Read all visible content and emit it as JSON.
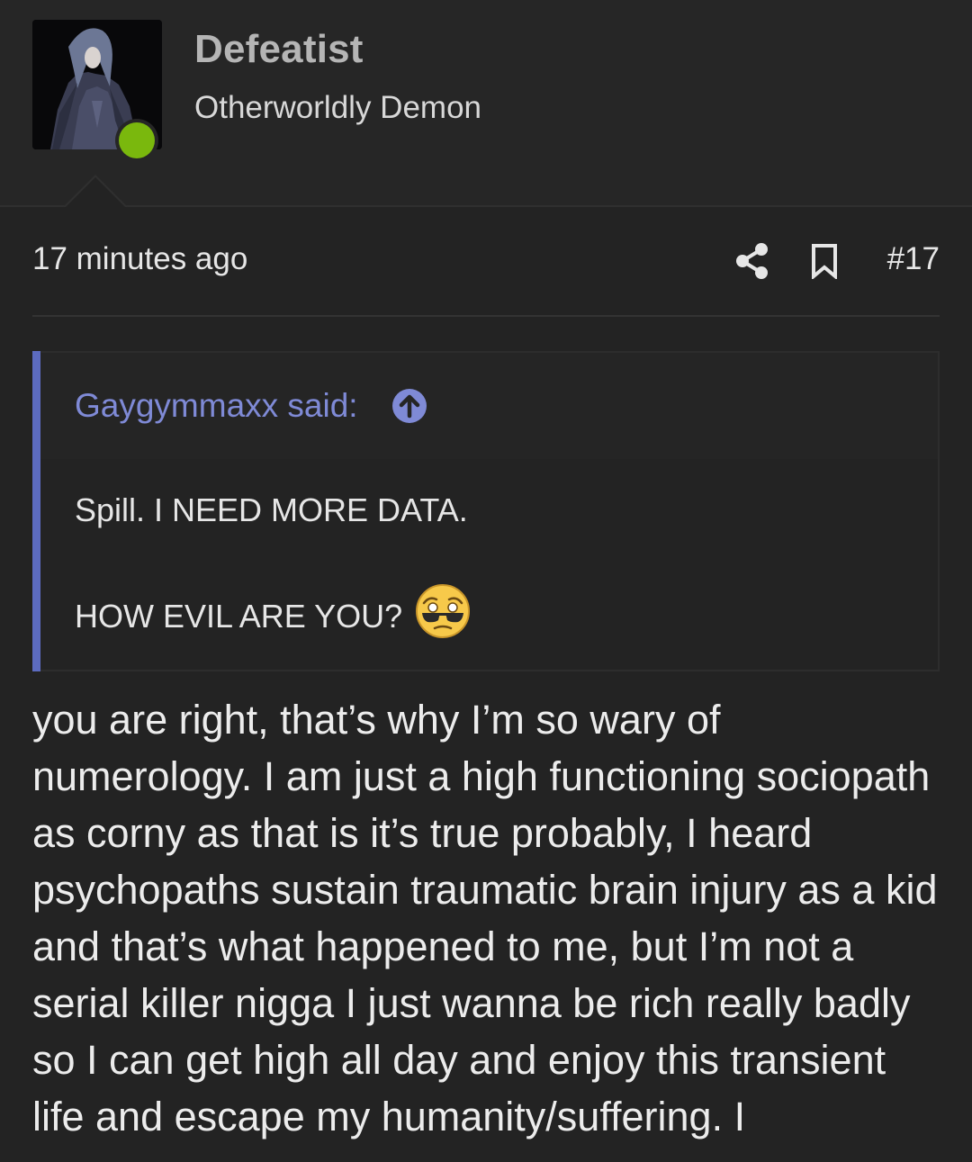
{
  "user": {
    "name": "Defeatist",
    "title": "Otherworldly Demon",
    "online": true,
    "online_color": "#7ab80d"
  },
  "post": {
    "timestamp": "17 minutes ago",
    "number": "#17",
    "icons": [
      "share-icon",
      "bookmark-icon"
    ]
  },
  "quote": {
    "author": "Gaygymmaxx said:",
    "lines": [
      "Spill. I NEED MORE DATA.",
      "HOW EVIL ARE YOU?"
    ],
    "emoji": "flushed-sunglasses-emoji",
    "accent_color": "#5c6bc0"
  },
  "body": {
    "text": "you are right, that’s why I’m so wary of numerology. I am just a high functioning sociopath as corny as that is it’s true probably, I heard psychopaths sustain traumatic brain injury as a kid and that’s what happened to me, but I’m not a serial killer nigga I just wanna be rich really badly so I can get high all day and enjoy this transient life and escape my humanity/suffering. I"
  }
}
